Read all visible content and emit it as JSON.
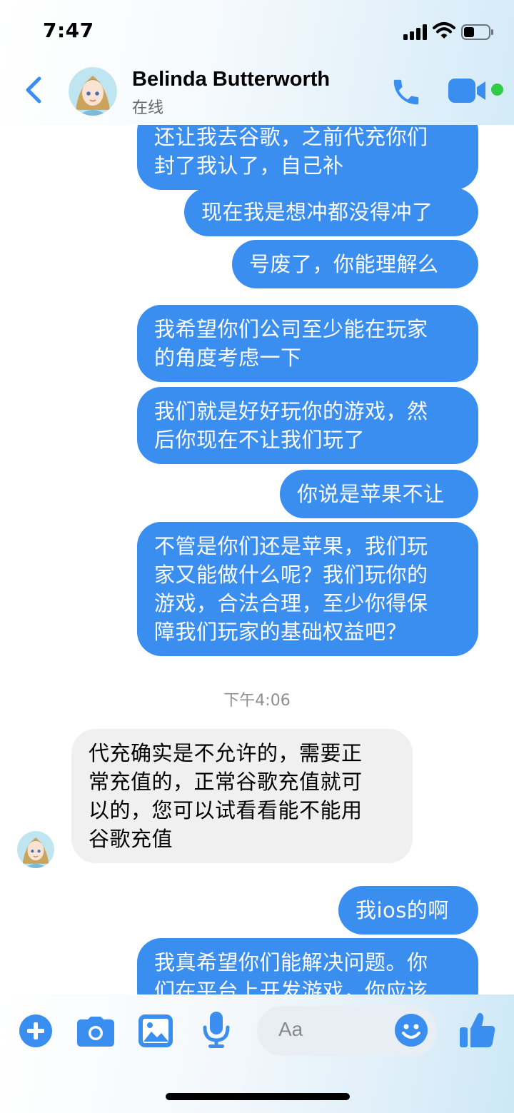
{
  "status_bar": {
    "time": "7:47"
  },
  "header": {
    "contact_name": "Belinda Butterworth",
    "contact_status": "在线"
  },
  "messages": [
    {
      "dir": "out",
      "text": "还让我去谷歌，之前代充你们\n封了我认了，自己补"
    },
    {
      "dir": "out",
      "text": "现在我是想冲都没得冲了"
    },
    {
      "dir": "out",
      "text": "号废了，你能理解么"
    },
    {
      "dir": "out",
      "text": "我希望你们公司至少能在玩家\n的角度考虑一下"
    },
    {
      "dir": "out",
      "text": "我们就是好好玩你的游戏，然\n后你现在不让我们玩了"
    },
    {
      "dir": "out",
      "text": "你说是苹果不让"
    },
    {
      "dir": "out",
      "text": "不管是你们还是苹果，我们玩\n家又能做什么呢？我们玩你的\n游戏，合法合理，至少你得保\n障我们玩家的基础权益吧？"
    },
    {
      "dir": "in",
      "text": "代充确实是不允许的，需要正\n常充值的，正常谷歌充值就可\n以的，您可以试看看能不能用\n谷歌充值"
    },
    {
      "dir": "out",
      "text": "我ios的啊"
    },
    {
      "dir": "out",
      "text": "我真希望你们能解决问题。你\n们在平台上开发游戏，你应该"
    }
  ],
  "timestamp": "下午4:06",
  "composer": {
    "placeholder": "Aa"
  },
  "colors": {
    "accent": "#3a8ef0",
    "incoming_bubble": "#f0f0f0",
    "online": "#31cc46"
  },
  "icons": [
    "back-chevron-icon",
    "phone-icon",
    "video-camera-icon",
    "plus-icon",
    "camera-icon",
    "photo-icon",
    "microphone-icon",
    "emoji-icon",
    "thumbs-up-icon"
  ]
}
